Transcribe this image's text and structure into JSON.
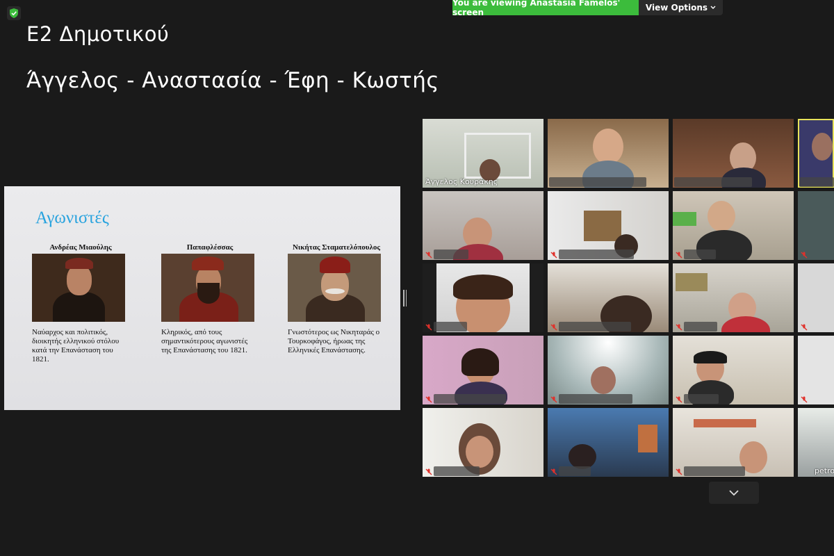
{
  "banner": {
    "viewing_text": "You are viewing Anastasia Famelos' screen",
    "view_options": "View Options"
  },
  "header": {
    "class_name": "Ε2 Δημοτικού",
    "student_names": "Άγγελος - Αναστασία - Έφη - Κωστής"
  },
  "slide": {
    "title": "Αγωνιστές",
    "fighters": [
      {
        "name": "Ανδρέας Μιαούλης",
        "description": "Ναύαρχος και πολιτικός, διοικητής ελληνικού στόλου κατά την Επανάσταση του 1821."
      },
      {
        "name": "Παπαφλέσσας",
        "description": "Κληρικός, από τους σημαντικότερους αγωνιστές της Επανάστασης του 1821."
      },
      {
        "name": "Νικήτας Σταματελόπουλος",
        "description": "Γνωστότερος ως Νικηταράς ο Τουρκοφάγος, ήρωας της Ελληνικές Επανάστασης."
      }
    ]
  },
  "participants": {
    "first_label": "Άγγελος Κουράκης",
    "last_label": "petro"
  },
  "colors": {
    "banner_green": "#3cbc3c",
    "background": "#1a1a1a",
    "slide_title_blue": "#29a3de",
    "active_speaker": "#e8e35a",
    "mute_red": "#e0312b"
  }
}
